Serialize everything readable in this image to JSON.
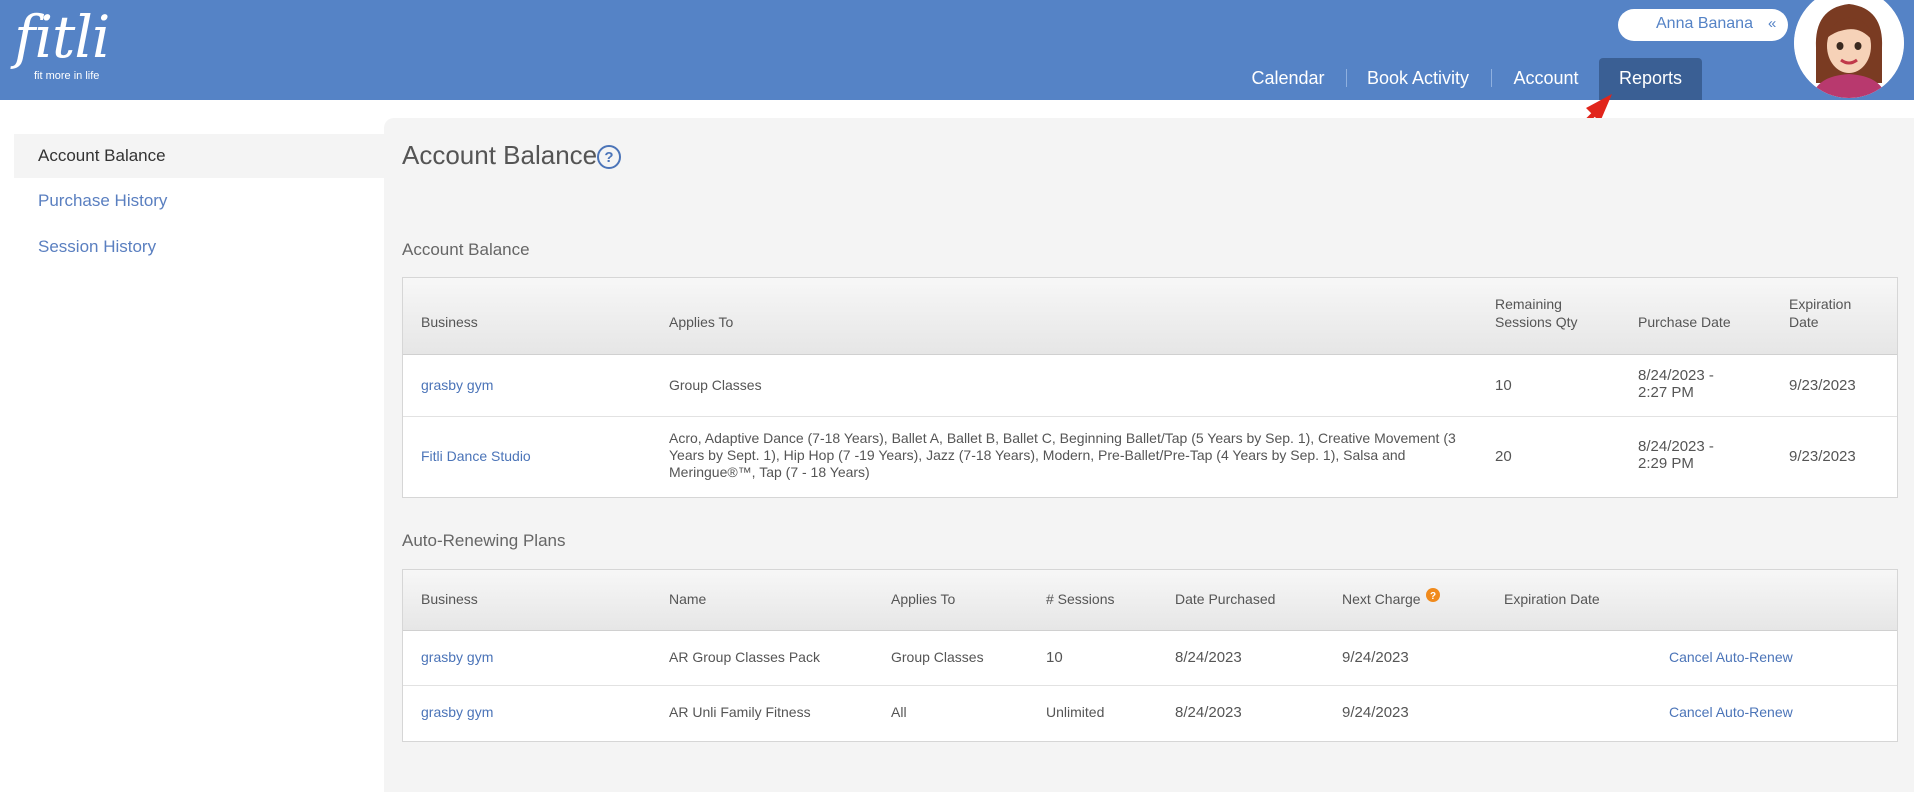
{
  "header": {
    "logo_word": "fitli",
    "logo_tagline": "fit more in life",
    "user_name": "Anna Banana",
    "user_menu_icon": "double-chevron-down-icon",
    "nav": [
      "Calendar",
      "Book Activity",
      "Account",
      "Reports"
    ],
    "active_nav": "Reports",
    "brand_color": "#5583c6"
  },
  "sidebar": {
    "items": [
      "Account Balance",
      "Purchase History",
      "Session History"
    ],
    "active": "Account Balance"
  },
  "page": {
    "title": "Account Balance",
    "help_icon": "question-circle-icon"
  },
  "account_balance": {
    "section_title": "Account Balance",
    "headers": {
      "business": "Business",
      "applies_to": "Applies To",
      "remaining_l1": "Remaining",
      "remaining_l2": "Sessions Qty",
      "purchase_date": "Purchase Date",
      "expiration_l1": "Expiration",
      "expiration_l2": "Date"
    },
    "rows": [
      {
        "business": "grasby gym",
        "applies_to": "Group Classes",
        "remaining": "10",
        "purchase_l1": "8/24/2023 -",
        "purchase_l2": "2:27 PM",
        "expiration": "9/23/2023"
      },
      {
        "business": "Fitli Dance Studio",
        "applies_to": "Acro, Adaptive Dance (7-18 Years), Ballet A, Ballet B, Ballet C, Beginning Ballet/Tap (5 Years by Sep. 1), Creative Movement (3 Years by Sept. 1), Hip Hop (7 -19 Years), Jazz (7-18 Years), Modern, Pre-Ballet/Pre-Tap (4 Years by Sep. 1), Salsa and Meringue®™, Tap (7 - 18 Years)",
        "remaining": "20",
        "purchase_l1": "8/24/2023 -",
        "purchase_l2": "2:29 PM",
        "expiration": "9/23/2023"
      }
    ]
  },
  "auto_renewing": {
    "section_title": "Auto-Renewing Plans",
    "headers": {
      "business": "Business",
      "name": "Name",
      "applies_to": "Applies To",
      "sessions": "# Sessions",
      "date_purchased": "Date Purchased",
      "next_charge": "Next Charge",
      "expiration": "Expiration Date"
    },
    "next_charge_icon": "info-badge-icon",
    "rows": [
      {
        "business": "grasby gym",
        "name": "AR Group Classes Pack",
        "applies_to": "Group Classes",
        "sessions": "10",
        "date_purchased": "8/24/2023",
        "next_charge": "9/24/2023",
        "expiration": "",
        "action": "Cancel Auto-Renew"
      },
      {
        "business": "grasby gym",
        "name": "AR Unli Family Fitness",
        "applies_to": "All",
        "sessions": "Unlimited",
        "date_purchased": "8/24/2023",
        "next_charge": "9/24/2023",
        "expiration": "",
        "action": "Cancel Auto-Renew"
      }
    ]
  }
}
